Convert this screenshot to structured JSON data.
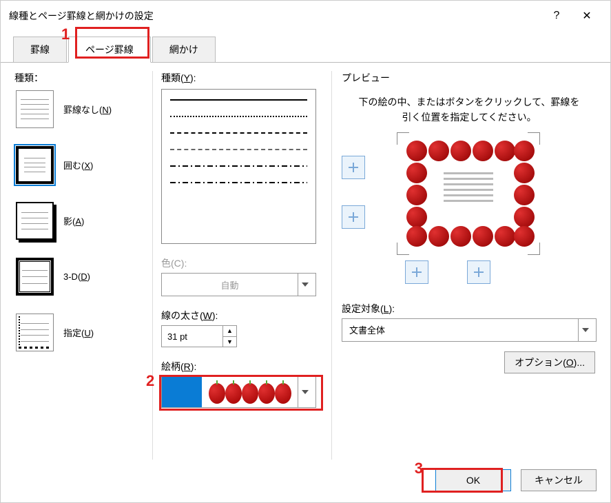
{
  "window": {
    "title": "線種とページ罫線と網かけの設定",
    "help": "?",
    "close": "✕"
  },
  "tabs": [
    {
      "label": "罫線"
    },
    {
      "label": "ページ罫線"
    },
    {
      "label": "網かけ"
    }
  ],
  "annots": {
    "n1": "1",
    "n2": "2",
    "n3": "3"
  },
  "left": {
    "section": "種類：",
    "items": [
      {
        "label": "罫線なし(",
        "u": "N",
        "after": ")"
      },
      {
        "label": "囲む(",
        "u": "X",
        "after": ")"
      },
      {
        "label": "影(",
        "u": "A",
        "after": ")"
      },
      {
        "label": "3-D(",
        "u": "D",
        "after": ")"
      },
      {
        "label": "指定(",
        "u": "U",
        "after": ")"
      }
    ]
  },
  "mid": {
    "style_label_pre": "種類(",
    "style_u": "Y",
    "style_label_post": "):",
    "color_label_pre": "色(",
    "color_u": "C",
    "color_label_post": "):",
    "color_value": "自動",
    "width_label_pre": "線の太さ(",
    "width_u": "W",
    "width_label_post": "):",
    "width_value": "31 pt",
    "art_label_pre": "絵柄(",
    "art_u": "R",
    "art_label_post": "):"
  },
  "right": {
    "preview_label": "プレビュー",
    "preview_desc": "下の絵の中、またはボタンをクリックして、罫線を引く位置を指定してください。",
    "apply_label_pre": "設定対象(",
    "apply_u": "L",
    "apply_label_post": "):",
    "apply_value": "文書全体",
    "options_pre": "オプション(",
    "options_u": "O",
    "options_post": ")..."
  },
  "footer": {
    "ok": "OK",
    "cancel": "キャンセル"
  }
}
